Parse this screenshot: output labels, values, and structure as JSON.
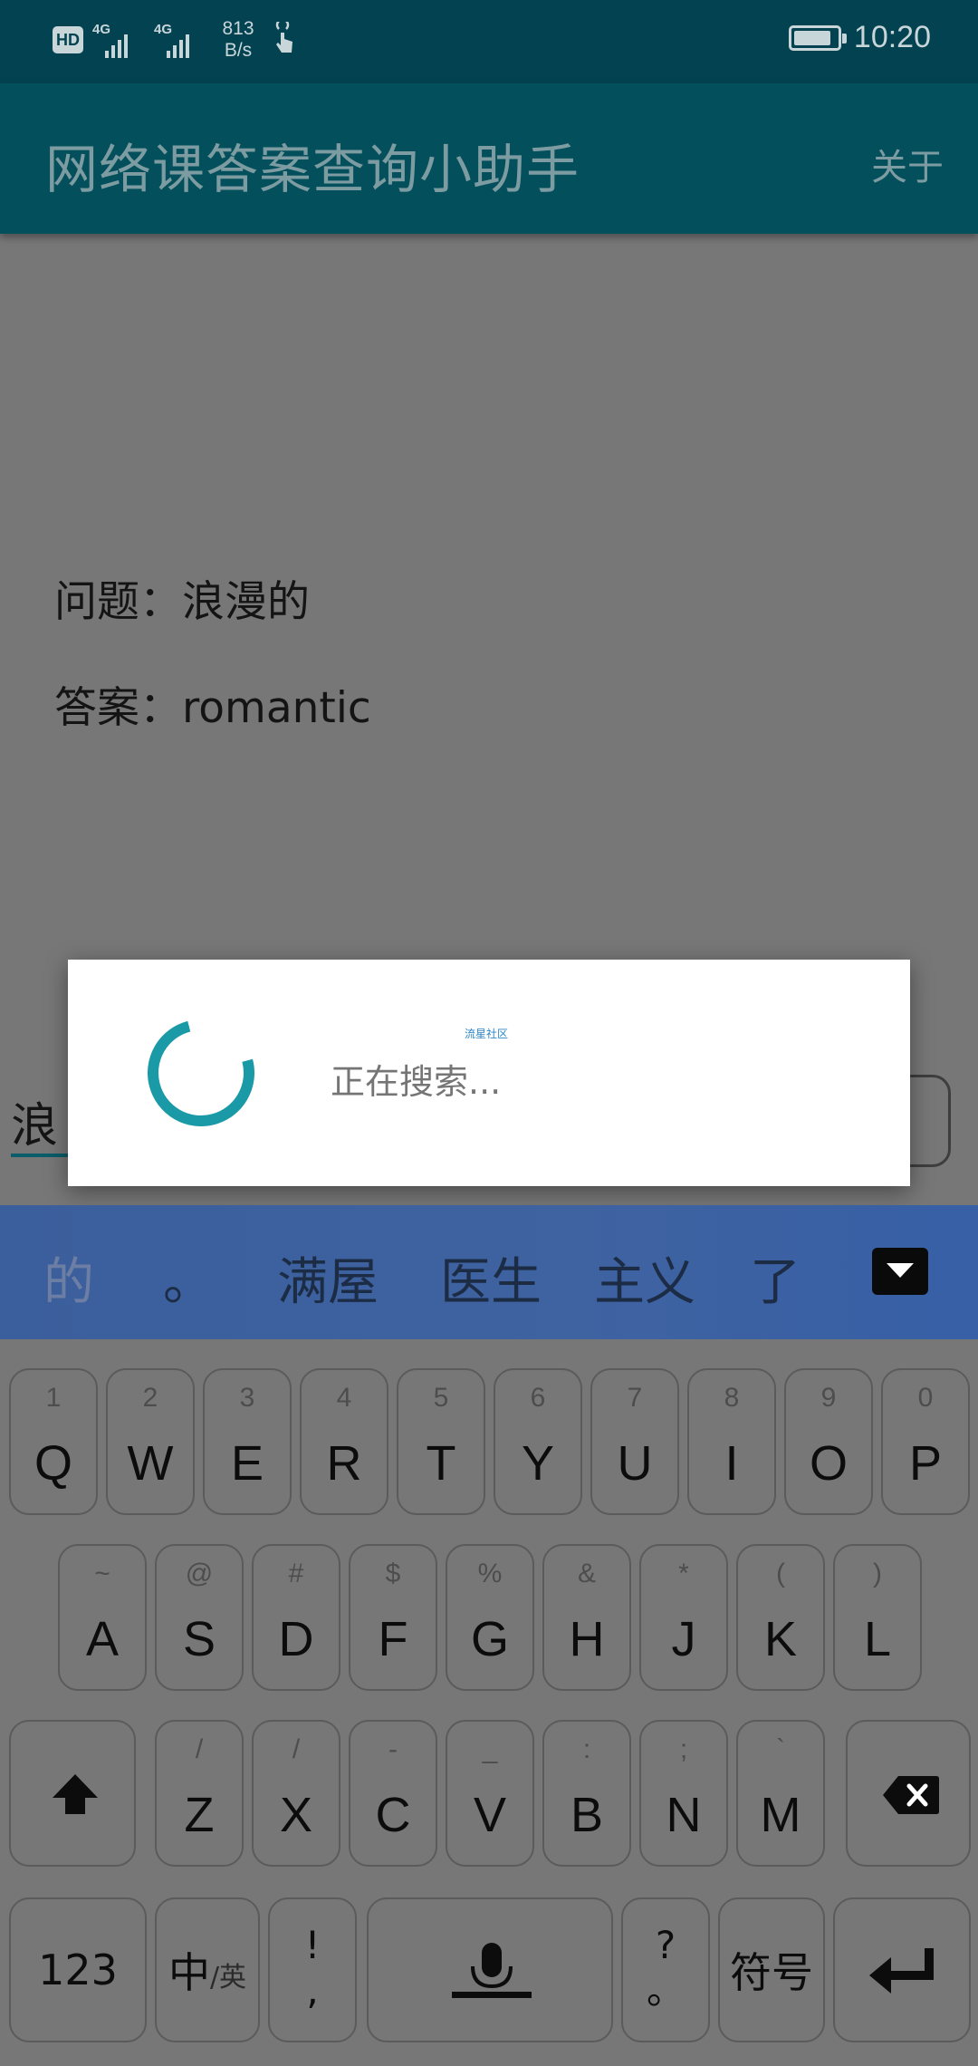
{
  "status_bar": {
    "hd_label": "HD",
    "network_1": "4G",
    "network_2": "4G",
    "speed_value": "813",
    "speed_unit": "B/s",
    "time": "10:20",
    "icons": [
      "hd-icon",
      "signal-icon",
      "signal-icon",
      "touch-icon",
      "battery-icon"
    ]
  },
  "app_bar": {
    "title": "网络课答案查询小助手",
    "about_label": "关于"
  },
  "content": {
    "question": "问题：浪漫的",
    "answer": "答案：romantic",
    "input_visible_text": "浪"
  },
  "dialog": {
    "message": "正在搜索...",
    "watermark": "流星社区",
    "accent_color": "#1a9aa6"
  },
  "candidates": {
    "items": [
      "的",
      "。",
      "满屋",
      "医生",
      "主义",
      "了"
    ]
  },
  "keyboard": {
    "row1": [
      {
        "hint": "1",
        "key": "Q"
      },
      {
        "hint": "2",
        "key": "W"
      },
      {
        "hint": "3",
        "key": "E"
      },
      {
        "hint": "4",
        "key": "R"
      },
      {
        "hint": "5",
        "key": "T"
      },
      {
        "hint": "6",
        "key": "Y"
      },
      {
        "hint": "7",
        "key": "U"
      },
      {
        "hint": "8",
        "key": "I"
      },
      {
        "hint": "9",
        "key": "O"
      },
      {
        "hint": "0",
        "key": "P"
      }
    ],
    "row2": [
      {
        "hint": "~",
        "key": "A"
      },
      {
        "hint": "@",
        "key": "S"
      },
      {
        "hint": "#",
        "key": "D"
      },
      {
        "hint": "$",
        "key": "F"
      },
      {
        "hint": "%",
        "key": "G"
      },
      {
        "hint": "&",
        "key": "H"
      },
      {
        "hint": "*",
        "key": "J"
      },
      {
        "hint": "(",
        "key": "K"
      },
      {
        "hint": ")",
        "key": "L"
      }
    ],
    "row3": [
      {
        "hint": "/",
        "key": "Z"
      },
      {
        "hint": "/",
        "key": "X"
      },
      {
        "hint": "-",
        "key": "C"
      },
      {
        "hint": "_",
        "key": "V"
      },
      {
        "hint": ":",
        "key": "B"
      },
      {
        "hint": ";",
        "key": "N"
      },
      {
        "hint": "`",
        "key": "M"
      }
    ],
    "numbers_label": "123",
    "lang_main": "中",
    "lang_sub": "/英",
    "punct_top": "!",
    "punct_bottom": ",",
    "question_top": "?",
    "question_bottom": "。",
    "symbols_label": "符号"
  }
}
